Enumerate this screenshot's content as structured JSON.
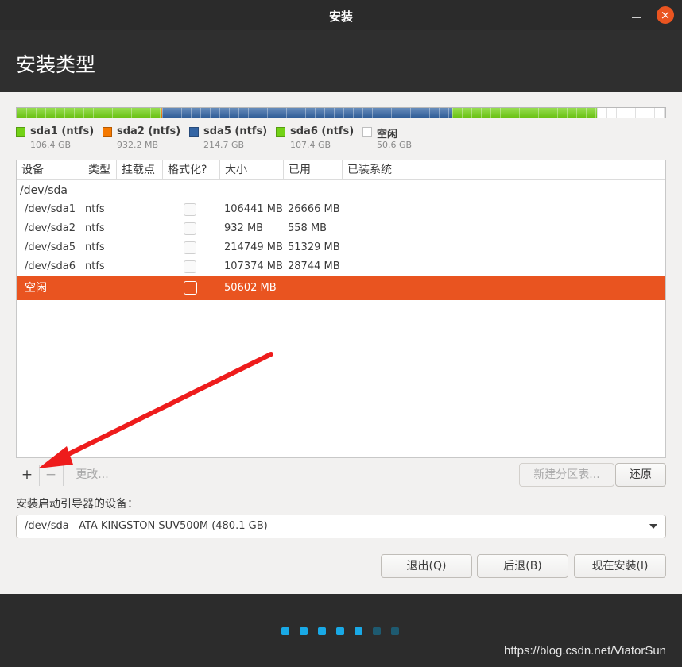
{
  "window": {
    "title": "安装",
    "close_glyph": "×"
  },
  "header": {
    "title": "安装类型"
  },
  "colors": {
    "ntfs_green": "#73d216",
    "ntfs_orange": "#f57900",
    "ntfs_blue": "#3465a4",
    "free_white": "#ffffff",
    "selection": "#e95420"
  },
  "partition_bar": [
    {
      "name": "sda1",
      "size_gb": 106.4,
      "color": "#73d216"
    },
    {
      "name": "sda2",
      "size_gb": 0.9,
      "color": "#f57900"
    },
    {
      "name": "sda5",
      "size_gb": 214.7,
      "color": "#3465a4"
    },
    {
      "name": "sda6",
      "size_gb": 107.4,
      "color": "#73d216"
    },
    {
      "name": "free",
      "size_gb": 50.6,
      "color": "#ffffff"
    }
  ],
  "legend": [
    {
      "name": "sda1 (ntfs)",
      "size": "106.4 GB",
      "color": "#73d216"
    },
    {
      "name": "sda2 (ntfs)",
      "size": "932.2 MB",
      "color": "#f57900"
    },
    {
      "name": "sda5 (ntfs)",
      "size": "214.7 GB",
      "color": "#3465a4"
    },
    {
      "name": "sda6 (ntfs)",
      "size": "107.4 GB",
      "color": "#73d216"
    },
    {
      "name": "空闲",
      "size": "50.6 GB",
      "color": "#ffffff"
    }
  ],
  "table": {
    "columns": [
      "设备",
      "类型",
      "挂载点",
      "格式化?",
      "大小",
      "已用",
      "已装系统"
    ],
    "disk": "/dev/sda",
    "rows": [
      {
        "device": "/dev/sda1",
        "type": "ntfs",
        "size": "106441 MB",
        "used": "26666 MB"
      },
      {
        "device": "/dev/sda2",
        "type": "ntfs",
        "size": "932 MB",
        "used": "558 MB"
      },
      {
        "device": "/dev/sda5",
        "type": "ntfs",
        "size": "214749 MB",
        "used": "51329 MB"
      },
      {
        "device": "/dev/sda6",
        "type": "ntfs",
        "size": "107374 MB",
        "used": "28744 MB"
      }
    ],
    "selected_row": {
      "device": "空闲",
      "size": "50602 MB"
    }
  },
  "toolbar": {
    "add": "+",
    "remove": "−",
    "change": "更改...",
    "new_table": "新建分区表...",
    "revert": "还原"
  },
  "boot": {
    "label": "安装启动引导器的设备：",
    "device": "/dev/sda   ATA KINGSTON SUV500M (480.1 GB)"
  },
  "buttons": {
    "quit": "退出(Q)",
    "back": "后退(B)",
    "install": "现在安装(I)"
  },
  "progress": {
    "total_steps": 7,
    "active_steps": 5
  },
  "watermark": "https://blog.csdn.net/ViatorSun"
}
